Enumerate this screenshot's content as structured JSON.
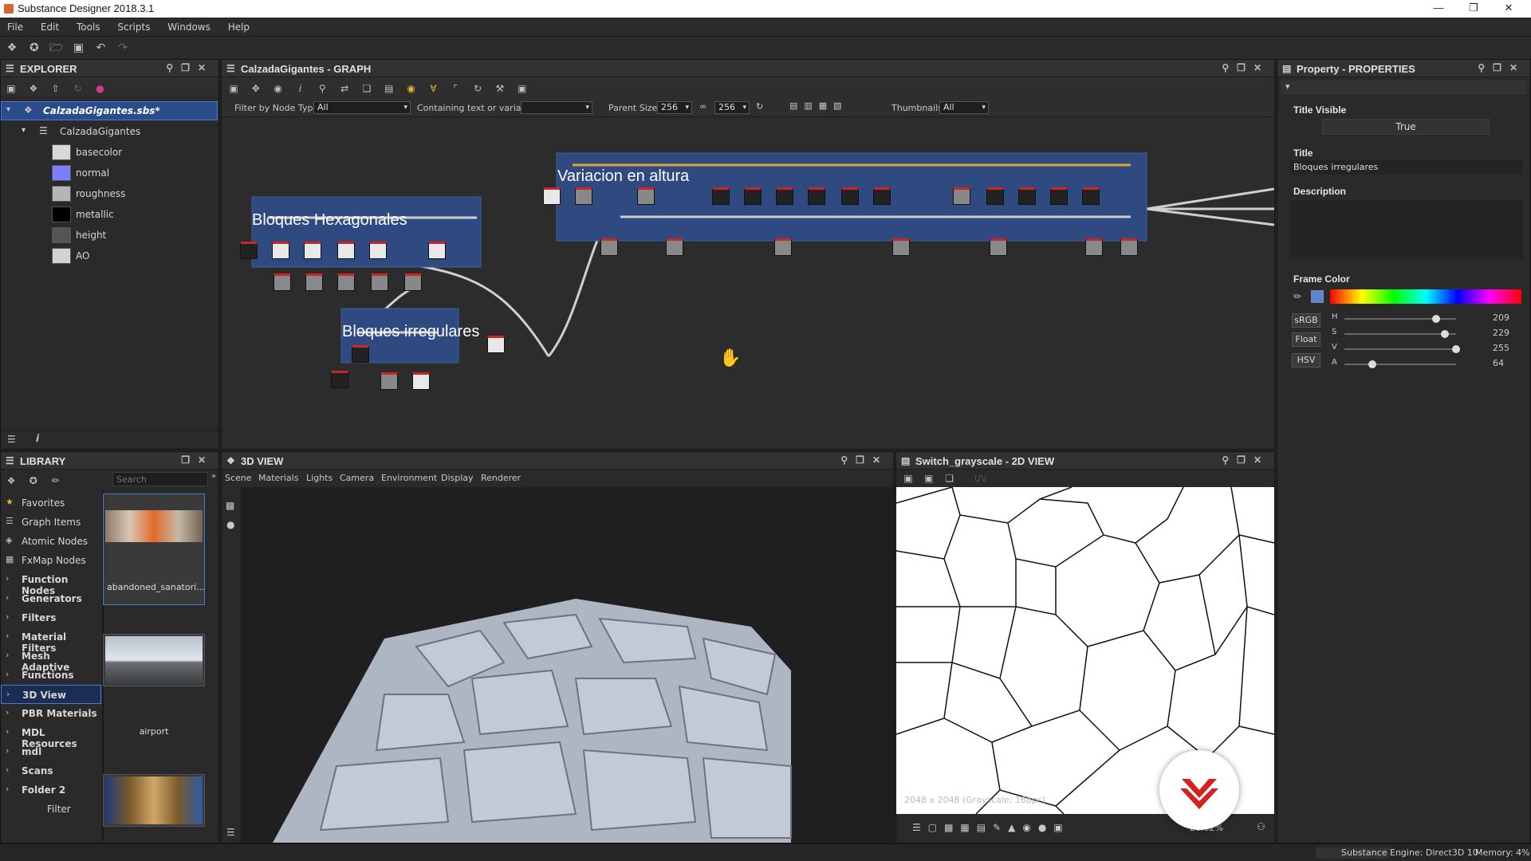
{
  "window": {
    "title": "Substance Designer 2018.3.1"
  },
  "menu": [
    "File",
    "Edit",
    "Tools",
    "Scripts",
    "Windows",
    "Help"
  ],
  "explorer": {
    "title": "EXPLORER",
    "package": "CalzadaGigantes.sbs*",
    "graph": "CalzadaGigantes",
    "outputs": [
      {
        "label": "basecolor",
        "color": "#d8d8d8"
      },
      {
        "label": "normal",
        "color": "#7a7fff"
      },
      {
        "label": "roughness",
        "color": "#b5b5b5"
      },
      {
        "label": "metallic",
        "color": "#000000"
      },
      {
        "label": "height",
        "color": "#555555"
      },
      {
        "label": "AO",
        "color": "#d2d2d2"
      }
    ]
  },
  "graph": {
    "title": "CalzadaGigantes - GRAPH",
    "filter_label": "Filter by Node Type",
    "filter_value": "All",
    "containing_label": "Containing text or variable",
    "containing_value": "",
    "parent_size_label": "Parent Size:",
    "parent_size_w": "256",
    "parent_size_h": "256",
    "thumbnails_label": "Thumbnails:",
    "thumbnails_value": "All",
    "frames": {
      "hex": "Bloques Hexagonales",
      "irr": "Bloques irregulares",
      "var": "Variacion en altura"
    }
  },
  "library": {
    "title": "LIBRARY",
    "search_placeholder": "Search",
    "items": [
      {
        "label": "Favorites",
        "bold": false,
        "icon": "star-icon"
      },
      {
        "label": "Graph Items",
        "bold": false,
        "icon": "graph-icon"
      },
      {
        "label": "Atomic Nodes",
        "bold": false,
        "icon": "atomic-icon"
      },
      {
        "label": "FxMap Nodes",
        "bold": false,
        "icon": "fxmap-icon"
      },
      {
        "label": "Function Nodes",
        "bold": true
      },
      {
        "label": "Generators",
        "bold": true
      },
      {
        "label": "Filters",
        "bold": true
      },
      {
        "label": "Material Filters",
        "bold": true
      },
      {
        "label": "Mesh Adaptive",
        "bold": true
      },
      {
        "label": "Functions",
        "bold": true
      },
      {
        "label": "3D View",
        "bold": true
      },
      {
        "label": "PBR Materials",
        "bold": true
      },
      {
        "label": "MDL Resources",
        "bold": true
      },
      {
        "label": "mdl",
        "bold": true
      },
      {
        "label": "Scans",
        "bold": true
      },
      {
        "label": "Folder 2",
        "bold": true
      },
      {
        "label": "Filter",
        "bold": false
      }
    ],
    "thumbs": [
      {
        "label": "abandoned_sanatori..."
      },
      {
        "label": "airport"
      },
      {
        "label": ""
      }
    ]
  },
  "view3d": {
    "title": "3D VIEW",
    "menu": [
      "Scene",
      "Materials",
      "Lights",
      "Camera",
      "Environment",
      "Display",
      "Renderer"
    ]
  },
  "view2d": {
    "title": "Switch_grayscale - 2D VIEW",
    "uv_label": "UV",
    "overlay": "2048 x 2048 (Grayscale, 16bpc)",
    "zoom": "28.62%"
  },
  "properties": {
    "title": "Property - PROPERTIES",
    "title_visible_label": "Title Visible",
    "title_visible_value": "True",
    "title_label": "Title",
    "title_value": "Bloques irregulares",
    "description_label": "Description",
    "frame_color_label": "Frame Color",
    "color_modes": [
      "sRGB",
      "Float",
      "HSV"
    ],
    "channels": [
      {
        "label": "H",
        "value": 209,
        "max": 255
      },
      {
        "label": "S",
        "value": 229,
        "max": 255
      },
      {
        "label": "V",
        "value": 255,
        "max": 255
      },
      {
        "label": "A",
        "value": 64,
        "max": 255
      }
    ]
  },
  "status": {
    "engine": "Substance Engine: Direct3D 10",
    "memory": "Memory: 4%"
  },
  "colors": {
    "frame_blue": "#2f4a80",
    "accent_red": "#d32020",
    "selection": "#2a4c8a"
  }
}
